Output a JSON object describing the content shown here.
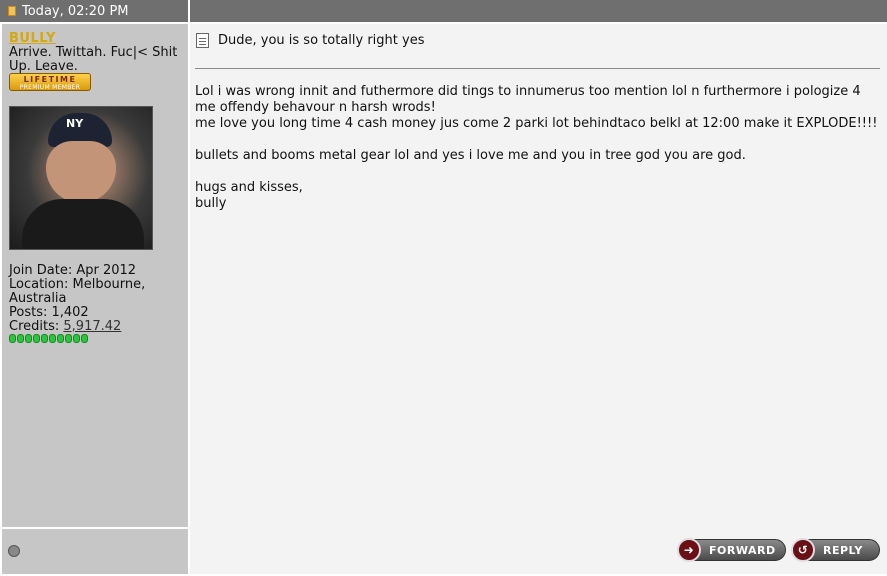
{
  "post": {
    "header": {
      "datetime": "Today, 02:20 PM"
    },
    "author": {
      "username": "BULLY",
      "user_title": "Arrive. Twittah. Fuc|< Shit Up. Leave.",
      "badge_line1": "LIFETIME",
      "badge_line2": "PREMIUM MEMBER",
      "join_date": "Join Date: Apr 2012",
      "location_label": "Location: Melbourne, Australia",
      "posts": "Posts: 1,402",
      "credits_label": "Credits: ",
      "credits_value": "5,917.42",
      "reputation_pips": 10,
      "avatar_cap_text": "NY"
    },
    "title": "Dude, you is so totally right yes",
    "message": {
      "line1": "Lol i was wrong innit and futhermore did tings to innumerus too mention lol n furthermore i pologize 4",
      "line2": "me offendy behavour n harsh wrods!",
      "line3": "me love you long time 4 cash money jus come 2 parki lot behindtaco belkl at 12:00 make it EXPLODE!!!!",
      "line4": "bullets and booms metal gear lol and yes i love me and you in tree god you are god.",
      "line5": "hugs and kisses,",
      "line6": "bully"
    },
    "buttons": {
      "forward": "FORWARD",
      "reply": "REPLY"
    },
    "colors": {
      "header_bg": "#6f6f6f",
      "sidebar_bg": "#c6c6c6",
      "content_bg": "#f3f3f3",
      "username": "#d4a812"
    }
  }
}
